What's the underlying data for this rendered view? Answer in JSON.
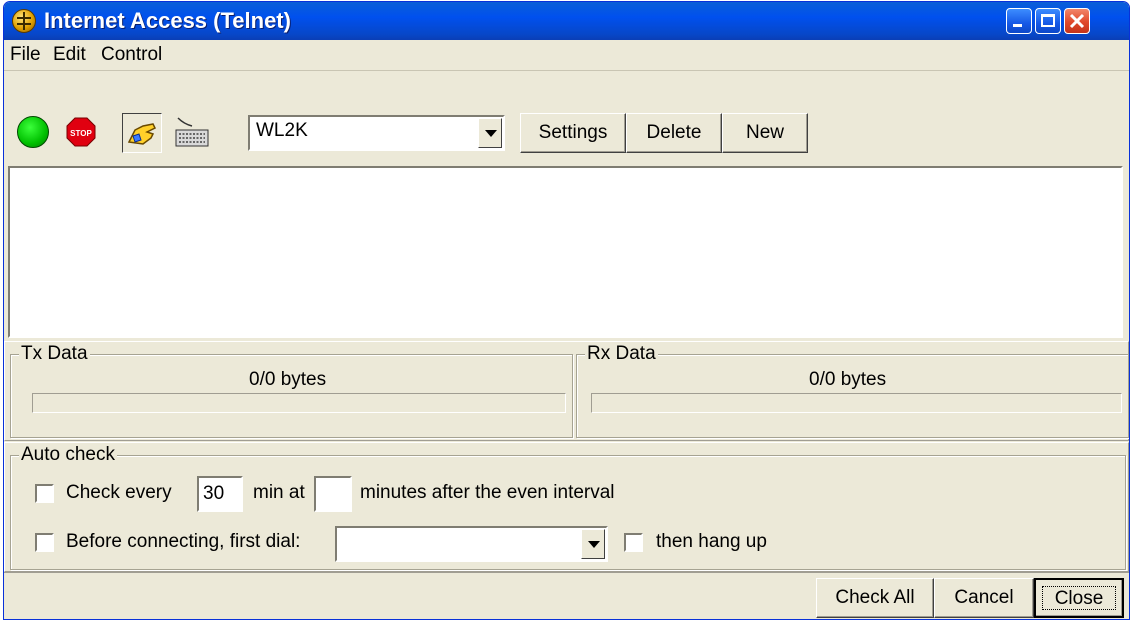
{
  "window": {
    "title": "Internet Access (Telnet)"
  },
  "menu": {
    "items": [
      "File",
      "Edit",
      "Control"
    ]
  },
  "toolbar": {
    "icons": [
      "go-icon",
      "stop-icon",
      "connect-hand-icon",
      "keyboard-icon"
    ],
    "connection": {
      "selected": "WL2K"
    },
    "settings_label": "Settings",
    "delete_label": "Delete",
    "new_label": "New"
  },
  "output": {
    "text": ""
  },
  "tx": {
    "label": "Tx Data",
    "bytes": "0/0 bytes",
    "progress": 0
  },
  "rx": {
    "label": "Rx Data",
    "bytes": "0/0 bytes",
    "progress": 0
  },
  "autocheck": {
    "label": "Auto check",
    "check_every_label": "Check every",
    "check_every_checked": false,
    "interval": "30",
    "min_at_label": "min at",
    "minutes_after": "",
    "minutes_after_label": "minutes after the even interval",
    "dial_label": "Before connecting, first dial:",
    "dial_checked": false,
    "dial_value": "",
    "hangup_label": "then hang up",
    "hangup_checked": false
  },
  "footer": {
    "check_all_label": "Check All",
    "cancel_label": "Cancel",
    "close_label": "Close"
  },
  "colors": {
    "title_bar": "#0054e3",
    "close_button": "#e0482a",
    "window_bg": "#ece9d8"
  }
}
